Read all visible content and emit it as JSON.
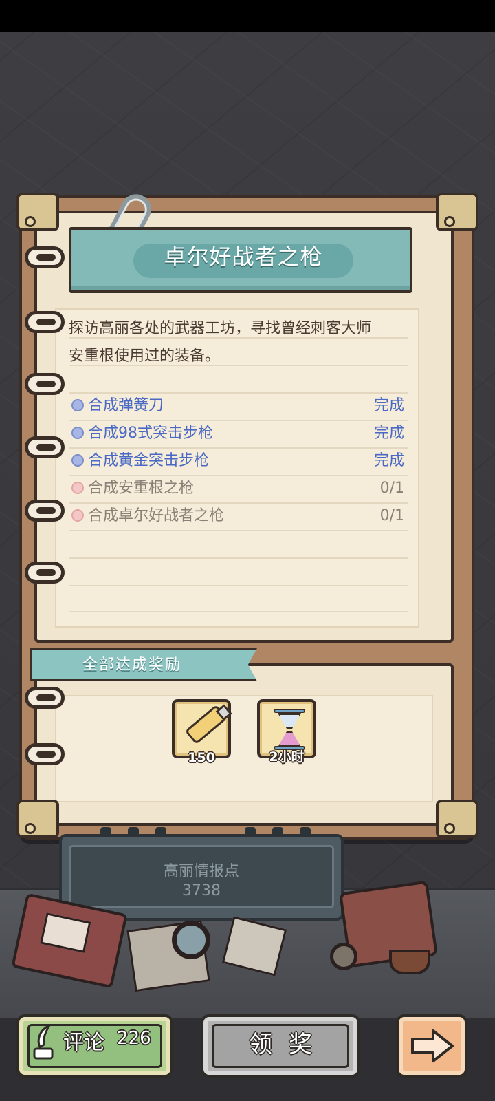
{
  "quest": {
    "title": "卓尔好战者之枪",
    "description_line1": "探访高丽各处的武器工坊，寻找曾经刺客大师",
    "description_line2": "安重根使用过的装备。",
    "tasks": [
      {
        "name": "合成弹簧刀",
        "status": "完成",
        "done": true
      },
      {
        "name": "合成98式突击步枪",
        "status": "完成",
        "done": true
      },
      {
        "name": "合成黄金突击步枪",
        "status": "完成",
        "done": true
      },
      {
        "name": "合成安重根之枪",
        "status": "0/1",
        "done": false
      },
      {
        "name": "合成卓尔好战者之枪",
        "status": "0/1",
        "done": false
      }
    ]
  },
  "rewards": {
    "header": "全部达成奖励",
    "items": [
      {
        "icon": "paint-tube-icon",
        "quantity": "150"
      },
      {
        "icon": "hourglass-icon",
        "quantity": "2小时"
      }
    ]
  },
  "intel": {
    "label": "高丽情报点",
    "value": "3738"
  },
  "buttons": {
    "comment_label": "评论",
    "comment_count": "226",
    "claim_label": "领奖",
    "next_icon": "arrow-right-icon"
  }
}
